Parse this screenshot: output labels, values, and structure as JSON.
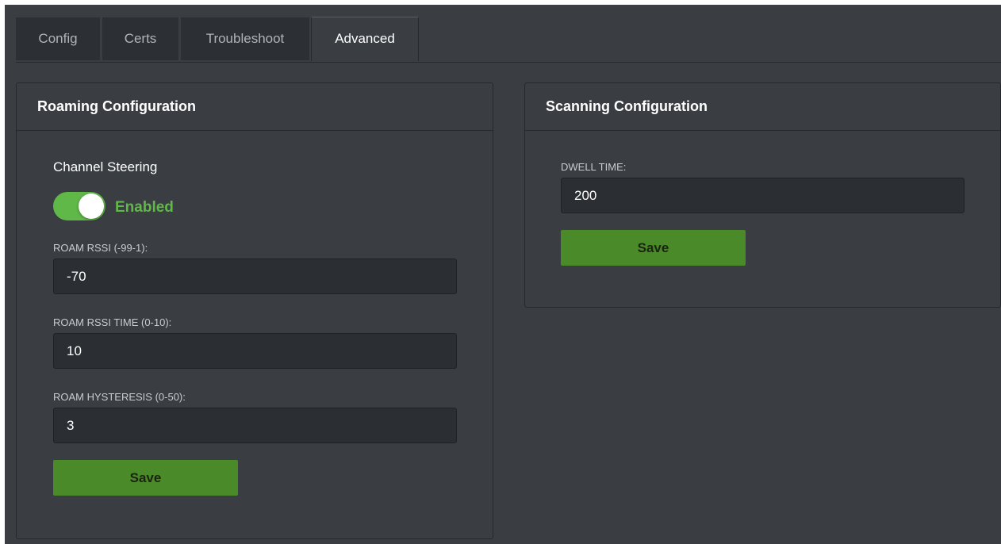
{
  "tabs": [
    {
      "label": "Config"
    },
    {
      "label": "Certs"
    },
    {
      "label": "Troubleshoot"
    },
    {
      "label": "Advanced"
    }
  ],
  "active_tab": "Advanced",
  "roaming": {
    "title": "Roaming Configuration",
    "channel_steering": {
      "label": "Channel Steering",
      "state_label": "Enabled",
      "enabled": true
    },
    "roam_rssi": {
      "label": "ROAM RSSI (-99-1):",
      "value": "-70"
    },
    "roam_rssi_time": {
      "label": "ROAM RSSI TIME (0-10):",
      "value": "10"
    },
    "roam_hysteresis": {
      "label": "ROAM HYSTERESIS (0-50):",
      "value": "3"
    },
    "save_label": "Save"
  },
  "scanning": {
    "title": "Scanning Configuration",
    "dwell_time": {
      "label": "DWELL TIME:",
      "value": "200"
    },
    "save_label": "Save"
  },
  "colors": {
    "background": "#3a3e42",
    "accent_green": "#5fb848",
    "button_green": "#4a8a28"
  }
}
